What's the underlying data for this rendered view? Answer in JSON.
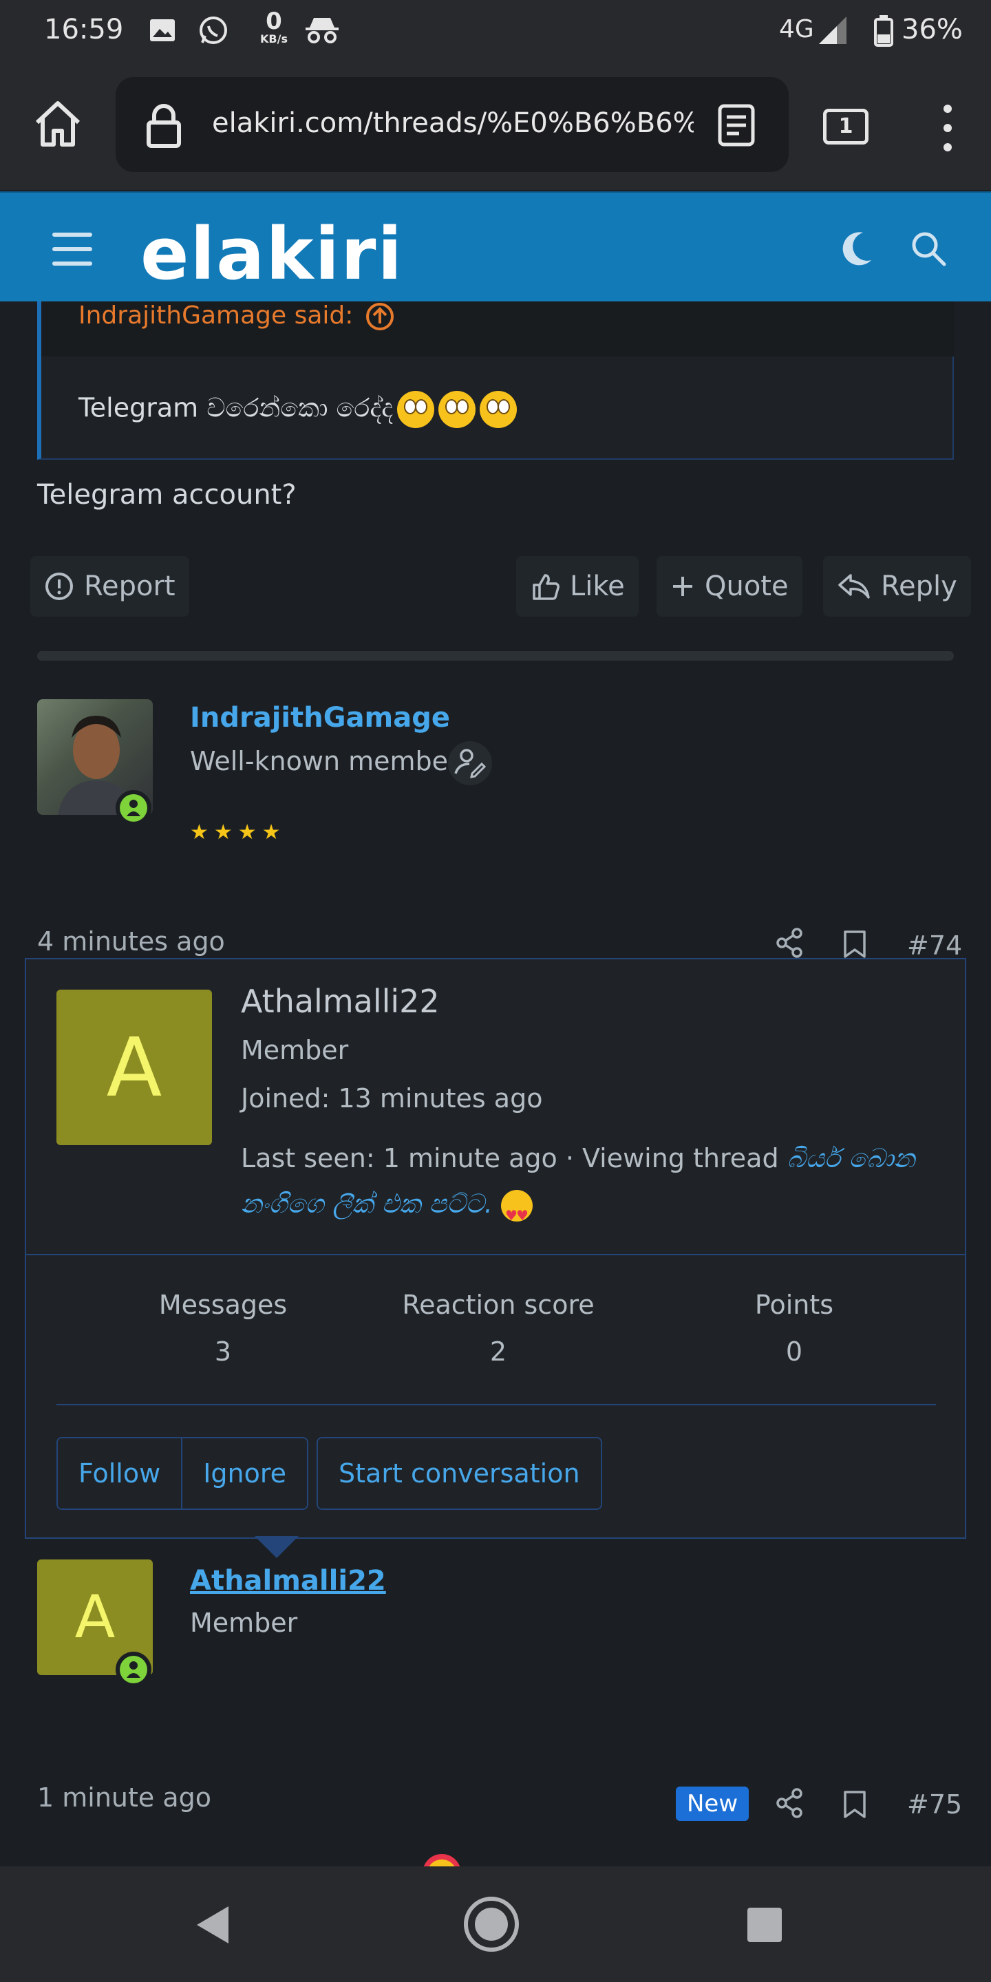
{
  "status_bar": {
    "time": "16:59",
    "net_speed": "0",
    "net_speed_unit": "KB/s",
    "network": "4G",
    "battery": "36%"
  },
  "browser": {
    "url": "elakiri.com/threads/%E0%B6%B6%E0%",
    "tab_count": "1"
  },
  "site": {
    "logo": "elakiri"
  },
  "quote": {
    "author": "IndrajithGamage said:",
    "text": "Telegram වරෙන්කො රෙද්ද"
  },
  "post": {
    "text": "Telegram account?",
    "actions": {
      "report": "Report",
      "like": "Like",
      "quote": "Quote",
      "reply": "Reply"
    }
  },
  "user1": {
    "name": "IndrajithGamage",
    "title": "Well-known member",
    "stars": "★★★★",
    "rating": 4
  },
  "post74": {
    "time": "4 minutes ago",
    "number": "#74"
  },
  "member_card": {
    "avatar_letter": "A",
    "name": "Athalmalli22",
    "role": "Member",
    "joined": "Joined: 13 minutes ago",
    "last_seen": "Last seen: 1 minute ago · Viewing thread",
    "thread_link": "බියර් බොන නංගිගෙ ලීක් එක පට්ට.",
    "stats": [
      {
        "label": "Messages",
        "value": "3"
      },
      {
        "label": "Reaction score",
        "value": "2"
      },
      {
        "label": "Points",
        "value": "0"
      }
    ],
    "buttons": {
      "follow": "Follow",
      "ignore": "Ignore",
      "start_conversation": "Start conversation"
    }
  },
  "user2": {
    "avatar_letter": "A",
    "name": "Athalmalli22",
    "title": "Member"
  },
  "post75": {
    "time": "1 minute ago",
    "badge": "New",
    "number": "#75"
  },
  "colors": {
    "header_blue": "#137ab8",
    "link_blue": "#47a7eb",
    "quote_orange": "#e87a2c",
    "avatar_olive": "#8b8c22",
    "online_green": "#7ed23a",
    "star_gold": "#f5c518"
  },
  "icons": [
    "image-icon",
    "whatsapp-icon",
    "incognito-icon",
    "signal-icon",
    "battery-icon",
    "home-icon",
    "lock-icon",
    "reader-mode-icon",
    "menu-dots-icon",
    "hamburger-icon",
    "moon-icon",
    "search-icon",
    "arrow-up-circle-icon",
    "alert-icon",
    "thumbs-up-icon",
    "plus-icon",
    "reply-icon",
    "user-edit-icon",
    "share-icon",
    "bookmark-icon",
    "back-icon",
    "home-circle-icon",
    "recents-icon"
  ]
}
